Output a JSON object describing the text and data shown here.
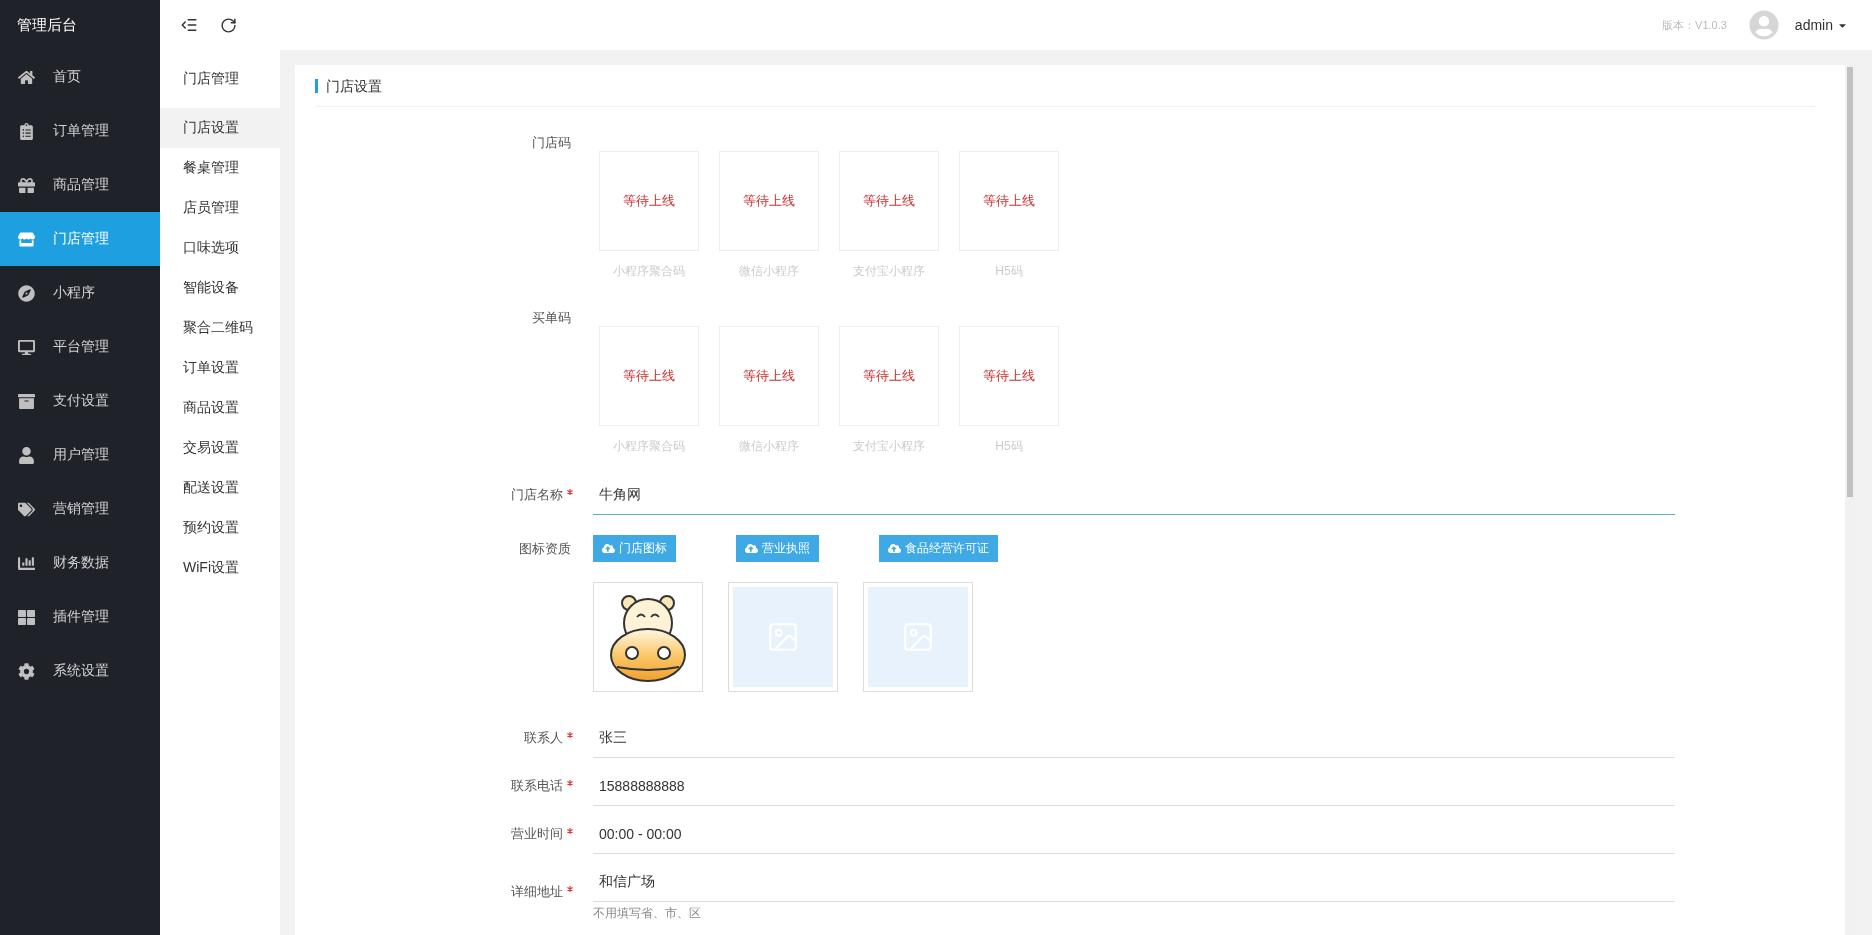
{
  "sidebar": {
    "title": "管理后台",
    "items": [
      {
        "label": "首页",
        "selected": false
      },
      {
        "label": "订单管理",
        "selected": false
      },
      {
        "label": "商品管理",
        "selected": false
      },
      {
        "label": "门店管理",
        "selected": true
      },
      {
        "label": "小程序",
        "selected": false
      },
      {
        "label": "平台管理",
        "selected": false
      },
      {
        "label": "支付设置",
        "selected": false
      },
      {
        "label": "用户管理",
        "selected": false
      },
      {
        "label": "营销管理",
        "selected": false
      },
      {
        "label": "财务数据",
        "selected": false
      },
      {
        "label": "插件管理",
        "selected": false
      },
      {
        "label": "系统设置",
        "selected": false
      }
    ]
  },
  "submenu": {
    "title": "门店管理",
    "items": [
      {
        "label": "门店设置",
        "selected": true
      },
      {
        "label": "餐桌管理",
        "selected": false
      },
      {
        "label": "店员管理",
        "selected": false
      },
      {
        "label": "口味选项",
        "selected": false
      },
      {
        "label": "智能设备",
        "selected": false
      },
      {
        "label": "聚合二维码",
        "selected": false
      },
      {
        "label": "订单设置",
        "selected": false
      },
      {
        "label": "商品设置",
        "selected": false
      },
      {
        "label": "交易设置",
        "selected": false
      },
      {
        "label": "配送设置",
        "selected": false
      },
      {
        "label": "预约设置",
        "selected": false
      },
      {
        "label": "WiFi设置",
        "selected": false
      }
    ]
  },
  "topbar": {
    "version": "版本：V1.0.3",
    "user": "admin"
  },
  "panel": {
    "title": "门店设置",
    "code_groups": [
      {
        "label": "门店码",
        "tiles": [
          {
            "status": "等待上线",
            "caption": "小程序聚合码"
          },
          {
            "status": "等待上线",
            "caption": "微信小程序"
          },
          {
            "status": "等待上线",
            "caption": "支付宝小程序"
          },
          {
            "status": "等待上线",
            "caption": "H5码"
          }
        ]
      },
      {
        "label": "买单码",
        "tiles": [
          {
            "status": "等待上线",
            "caption": "小程序聚合码"
          },
          {
            "status": "等待上线",
            "caption": "微信小程序"
          },
          {
            "status": "等待上线",
            "caption": "支付宝小程序"
          },
          {
            "status": "等待上线",
            "caption": "H5码"
          }
        ]
      }
    ],
    "store_name": {
      "label": "门店名称",
      "required": true,
      "value": "牛角网",
      "focused": true
    },
    "uploads": {
      "label": "图标资质",
      "items": [
        {
          "button": "门店图标",
          "kind": "logo"
        },
        {
          "button": "营业执照",
          "kind": "empty"
        },
        {
          "button": "食品经营许可证",
          "kind": "empty"
        }
      ]
    },
    "fields": [
      {
        "label": "联系人",
        "required": true,
        "value": "张三",
        "focused": false
      },
      {
        "label": "联系电话",
        "required": true,
        "value": "15888888888",
        "focused": false
      },
      {
        "label": "营业时间",
        "required": true,
        "value": "00:00 - 00:00",
        "focused": false
      },
      {
        "label": "详细地址",
        "required": true,
        "value": "和信广场",
        "focused": false,
        "hint": "不用填写省、市、区"
      }
    ]
  }
}
